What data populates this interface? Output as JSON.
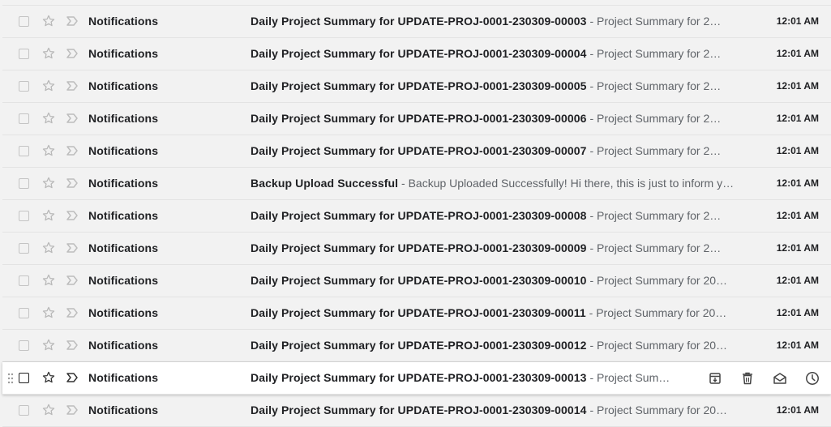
{
  "emails": [
    {
      "sender": "Notifications",
      "subject": "Daily Project Summary for UPDATE-PROJ-0001-230309-00003",
      "snippet": "Project Summary for 2…",
      "time": "12:01 AM"
    },
    {
      "sender": "Notifications",
      "subject": "Daily Project Summary for UPDATE-PROJ-0001-230309-00004",
      "snippet": "Project Summary for 2…",
      "time": "12:01 AM"
    },
    {
      "sender": "Notifications",
      "subject": "Daily Project Summary for UPDATE-PROJ-0001-230309-00005",
      "snippet": "Project Summary for 2…",
      "time": "12:01 AM"
    },
    {
      "sender": "Notifications",
      "subject": "Daily Project Summary for UPDATE-PROJ-0001-230309-00006",
      "snippet": "Project Summary for 2…",
      "time": "12:01 AM"
    },
    {
      "sender": "Notifications",
      "subject": "Daily Project Summary for UPDATE-PROJ-0001-230309-00007",
      "snippet": "Project Summary for 2…",
      "time": "12:01 AM"
    },
    {
      "sender": "Notifications",
      "subject": "Backup Upload Successful",
      "snippet": "Backup Uploaded Successfully! Hi there, this is just to inform y…",
      "time": "12:01 AM"
    },
    {
      "sender": "Notifications",
      "subject": "Daily Project Summary for UPDATE-PROJ-0001-230309-00008",
      "snippet": "Project Summary for 2…",
      "time": "12:01 AM"
    },
    {
      "sender": "Notifications",
      "subject": "Daily Project Summary for UPDATE-PROJ-0001-230309-00009",
      "snippet": "Project Summary for 2…",
      "time": "12:01 AM"
    },
    {
      "sender": "Notifications",
      "subject": "Daily Project Summary for UPDATE-PROJ-0001-230309-00010",
      "snippet": "Project Summary for 20…",
      "time": "12:01 AM"
    },
    {
      "sender": "Notifications",
      "subject": "Daily Project Summary for UPDATE-PROJ-0001-230309-00011",
      "snippet": "Project Summary for 20…",
      "time": "12:01 AM"
    },
    {
      "sender": "Notifications",
      "subject": "Daily Project Summary for UPDATE-PROJ-0001-230309-00012",
      "snippet": "Project Summary for 20…",
      "time": "12:01 AM"
    },
    {
      "sender": "Notifications",
      "subject": "Daily Project Summary for UPDATE-PROJ-0001-230309-00013",
      "snippet": "Project Sum…",
      "time": "",
      "hovered": true
    },
    {
      "sender": "Notifications",
      "subject": "Daily Project Summary for UPDATE-PROJ-0001-230309-00014",
      "snippet": "Project Summary for 20…",
      "time": "12:01 AM"
    }
  ],
  "separator": "-",
  "hover_actions": [
    "archive-icon",
    "trash-icon",
    "mark-as-read-icon",
    "snooze-icon"
  ],
  "colors": {
    "row_bg": "#f2f2f2",
    "hover_bg": "#ffffff",
    "text": "#202124",
    "snippet": "#5f6368",
    "divider": "#e3e3e3"
  }
}
